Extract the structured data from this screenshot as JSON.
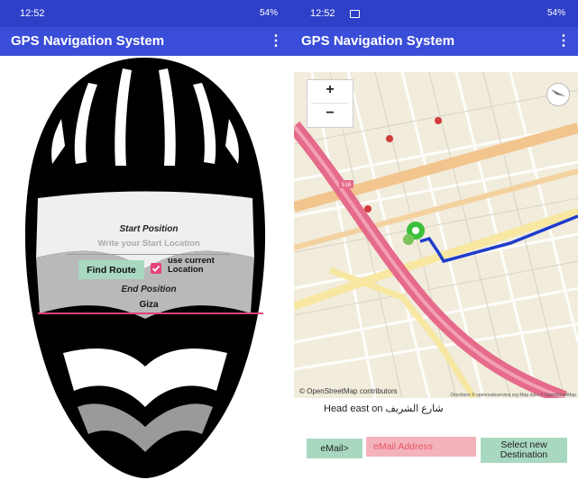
{
  "statusbar": {
    "time": "12:52",
    "icons_text": "54%"
  },
  "appbar": {
    "title": "GPS Navigation System",
    "menu_icon": "⋮"
  },
  "route_form": {
    "start_title": "Start Position",
    "start_placeholder": "Write your Start Location",
    "find_route_label": "Find Route",
    "use_current_location_label": "use current Location",
    "use_current_location_checked": true,
    "end_title": "End Position",
    "end_value": "Giza"
  },
  "map": {
    "zoom_in_label": "+",
    "zoom_out_label": "−",
    "attribution": "© OpenStreetMap contributors",
    "directions_attribution": "Directions © openrouteservice.org  Map data © OpenStreetMap",
    "road_label": "516"
  },
  "navigation": {
    "instruction": "Head east on شارع الشريف",
    "email_button_label": "eMail>",
    "email_placeholder": "eMail Address",
    "select_destination_label": "Select new Destination"
  },
  "colors": {
    "status_bar": "#2f40c8",
    "app_bar": "#3a4dd8",
    "accent_pink": "#e0437a",
    "button_green": "#a8d8c0",
    "route_blue": "#1f3ccc"
  }
}
